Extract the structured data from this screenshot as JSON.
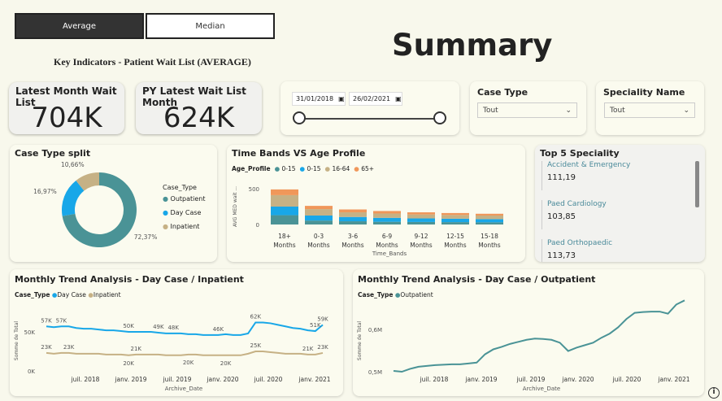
{
  "toggle": {
    "average": "Average",
    "median": "Median"
  },
  "page_title": "Summary",
  "subtitle": "Key Indicators - Patient Wait List (AVERAGE)",
  "kpis": [
    {
      "label": "Latest Month Wait List",
      "value": "704K"
    },
    {
      "label": "PY Latest Wait List Month",
      "value": "624K"
    }
  ],
  "date_slicer": {
    "start": "31/01/2018",
    "end": "26/02/2021"
  },
  "case_type_filter": {
    "title": "Case Type",
    "value": "Tout"
  },
  "speciality_filter": {
    "title": "Speciality Name",
    "value": "Tout"
  },
  "donut": {
    "title": "Case Type split",
    "legend_title": "Case_Type",
    "slices": [
      {
        "name": "Outpatient",
        "pct": 72.37,
        "label": "72,37%",
        "color": "#4a9396"
      },
      {
        "name": "Day Case",
        "pct": 16.97,
        "label": "16,97%",
        "color": "#18a7e8"
      },
      {
        "name": "Inpatient",
        "pct": 10.66,
        "label": "10,66%",
        "color": "#c6b185"
      }
    ]
  },
  "time_bands": {
    "title": "Time Bands VS Age Profile",
    "legend_title": "Age_Profile",
    "legend": [
      {
        "name": "0-15",
        "color": "#4a9396"
      },
      {
        "name": "0-15",
        "color": "#18a7e8"
      },
      {
        "name": "16-64",
        "color": "#c6b185"
      },
      {
        "name": "65+",
        "color": "#f0975a"
      }
    ],
    "ylabel": "AVG MED wait ...",
    "xlabel": "Time_Bands",
    "yticks": [
      "500",
      "0"
    ],
    "categories": [
      [
        "18+",
        "Months"
      ],
      [
        "0-3",
        "Months"
      ],
      [
        "3-6",
        "Months"
      ],
      [
        "6-9",
        "Months"
      ],
      [
        "9-12",
        "Months"
      ],
      [
        "12-15",
        "Months"
      ],
      [
        "15-18",
        "Months"
      ]
    ]
  },
  "chart_data": [
    {
      "type": "pie",
      "title": "Case Type split",
      "categories": [
        "Outpatient",
        "Day Case",
        "Inpatient"
      ],
      "values": [
        72.37,
        16.97,
        10.66
      ]
    },
    {
      "type": "bar",
      "title": "Time Bands VS Age Profile",
      "categories": [
        "18+ Months",
        "0-3 Months",
        "3-6 Months",
        "6-9 Months",
        "9-12 Months",
        "12-15 Months",
        "15-18 Months"
      ],
      "series": [
        {
          "name": "0-15",
          "values": [
            130,
            55,
            45,
            38,
            35,
            33,
            30
          ]
        },
        {
          "name": "0-15",
          "values": [
            120,
            70,
            60,
            55,
            50,
            48,
            45
          ]
        },
        {
          "name": "16-64",
          "values": [
            160,
            90,
            65,
            60,
            55,
            52,
            50
          ]
        },
        {
          "name": "65+",
          "values": [
            80,
            45,
            40,
            35,
            30,
            27,
            25
          ]
        }
      ],
      "ylim": [
        0,
        500
      ]
    },
    {
      "type": "line",
      "title": "Monthly Trend Analysis - Day Case / Inpatient",
      "xlabel": "Archive_Date",
      "ylabel": "Somme de Total",
      "yticks": [
        "50K",
        "0K"
      ],
      "xticks": [
        "juil. 2018",
        "janv. 2019",
        "juil. 2019",
        "janv. 2020",
        "juil. 2020",
        "janv. 2021"
      ],
      "legend_title": "Case_Type",
      "series": [
        {
          "name": "Day Case",
          "color": "#18a7e8",
          "values": [
            57,
            56,
            57,
            57,
            55,
            54,
            54,
            53,
            52,
            52,
            51,
            50,
            50,
            50,
            50,
            49,
            48,
            48,
            48,
            47,
            47,
            46,
            46,
            46,
            47,
            46,
            46,
            48,
            62,
            62,
            61,
            59,
            57,
            55,
            54,
            52,
            51,
            59
          ]
        },
        {
          "name": "Inpatient",
          "color": "#c6b185",
          "values": [
            23,
            22,
            23,
            23,
            22,
            22,
            22,
            22,
            21,
            21,
            21,
            20,
            21,
            21,
            21,
            21,
            20,
            20,
            20,
            21,
            21,
            20,
            20,
            20,
            20,
            20,
            20,
            22,
            25,
            25,
            24,
            23,
            22,
            22,
            22,
            21,
            21,
            23
          ]
        }
      ],
      "point_labels": [
        {
          "text": "57K",
          "i": 0,
          "s": 0
        },
        {
          "text": "57K",
          "i": 2,
          "s": 0
        },
        {
          "text": "50K",
          "i": 11,
          "s": 0
        },
        {
          "text": "49K",
          "i": 15,
          "s": 0
        },
        {
          "text": "48K",
          "i": 17,
          "s": 0
        },
        {
          "text": "46K",
          "i": 23,
          "s": 0
        },
        {
          "text": "62K",
          "i": 28,
          "s": 0
        },
        {
          "text": "51K",
          "i": 36,
          "s": 0
        },
        {
          "text": "59K",
          "i": 37,
          "s": 0
        },
        {
          "text": "23K",
          "i": 0,
          "s": 1
        },
        {
          "text": "23K",
          "i": 3,
          "s": 1
        },
        {
          "text": "21K",
          "i": 12,
          "s": 1
        },
        {
          "text": "20K",
          "i": 11,
          "s": 1
        },
        {
          "text": "20K",
          "i": 19,
          "s": 1
        },
        {
          "text": "20K",
          "i": 24,
          "s": 1
        },
        {
          "text": "25K",
          "i": 28,
          "s": 1
        },
        {
          "text": "21K",
          "i": 35,
          "s": 1
        },
        {
          "text": "23K",
          "i": 37,
          "s": 1
        }
      ]
    },
    {
      "type": "line",
      "title": "Monthly Trend Analysis - Day Case / Outpatient",
      "xlabel": "Archive_Date",
      "ylabel": "Somme de Total",
      "yticks": [
        "0,6M",
        "0,5M"
      ],
      "xticks": [
        "juil. 2018",
        "janv. 2019",
        "juil. 2019",
        "janv. 2020",
        "juil. 2020",
        "janv. 2021"
      ],
      "legend_title": "Case_Type",
      "series": [
        {
          "name": "Outpatient",
          "color": "#4a9396",
          "values": [
            0.5,
            0.498,
            0.505,
            0.51,
            0.512,
            0.514,
            0.515,
            0.516,
            0.516,
            0.518,
            0.52,
            0.54,
            0.552,
            0.558,
            0.565,
            0.57,
            0.575,
            0.578,
            0.577,
            0.575,
            0.568,
            0.548,
            0.556,
            0.562,
            0.568,
            0.58,
            0.59,
            0.605,
            0.625,
            0.64,
            0.642,
            0.643,
            0.643,
            0.638,
            0.66,
            0.67
          ]
        }
      ]
    }
  ],
  "line1": {
    "title": "Monthly Trend Analysis - Day Case / Inpatient",
    "legend_title": "Case_Type",
    "legend": [
      {
        "name": "Day Case",
        "color": "#18a7e8"
      },
      {
        "name": "Inpatient",
        "color": "#c6b185"
      }
    ],
    "ylabel": "Somme de Total",
    "xlabel": "Archive_Date",
    "yticks": [
      "50K",
      "0K"
    ],
    "xticks": [
      "juil. 2018",
      "janv. 2019",
      "juil. 2019",
      "janv. 2020",
      "juil. 2020",
      "janv. 2021"
    ]
  },
  "line2": {
    "title": "Monthly Trend Analysis - Day Case / Outpatient",
    "legend_title": "Case_Type",
    "legend": [
      {
        "name": "Outpatient",
        "color": "#4a9396"
      }
    ],
    "ylabel": "Somme de Total",
    "xlabel": "Archive_Date",
    "yticks": [
      "0,6M",
      "0,5M"
    ],
    "xticks": [
      "juil. 2018",
      "janv. 2019",
      "juil. 2019",
      "janv. 2020",
      "juil. 2020",
      "janv. 2021"
    ]
  },
  "top5": {
    "title": "Top 5 Speciality",
    "items": [
      {
        "name": "Accident & Emergency",
        "value": "111,19"
      },
      {
        "name": "Paed Cardiology",
        "value": "103,85"
      },
      {
        "name": "Paed Orthopaedic",
        "value": "113,73"
      }
    ]
  },
  "info_icon": "info-icon"
}
